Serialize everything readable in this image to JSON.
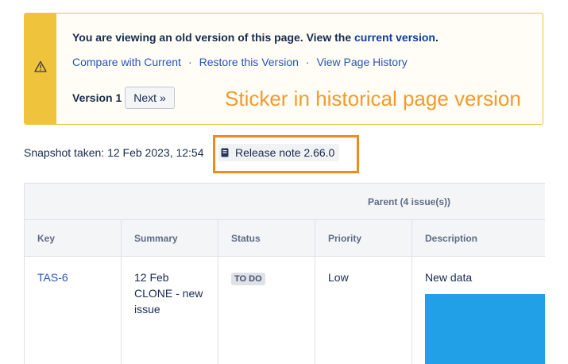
{
  "banner": {
    "message": "You are viewing an old version of this page. View the ",
    "current_link": "current version",
    "period": ".",
    "links": [
      "Compare with Current",
      "Restore this Version",
      "View Page History"
    ],
    "separator": "·",
    "version_label": "Version 1",
    "next_button": "Next »",
    "icon": "warning-icon",
    "stripe_color": "#f0c33c"
  },
  "annotation": {
    "text": "Sticker in historical page version",
    "color": "#f39a2b",
    "box_color": "#f28a1a"
  },
  "snapshot": {
    "text": "Snapshot taken: 12 Feb 2023, 12:54",
    "sticker_label": "Release note 2.66.0",
    "sticker_icon": "document-icon"
  },
  "table": {
    "group_header": "Parent (4 issue(s))",
    "columns": [
      "Key",
      "Summary",
      "Status",
      "Priority",
      "Description"
    ],
    "rows": [
      {
        "key": "TAS-6",
        "summary": "12 Feb CLONE - new issue",
        "status": "TO DO",
        "priority": "Low",
        "description": "New data",
        "description_image_color": "#22a0e7"
      }
    ]
  }
}
